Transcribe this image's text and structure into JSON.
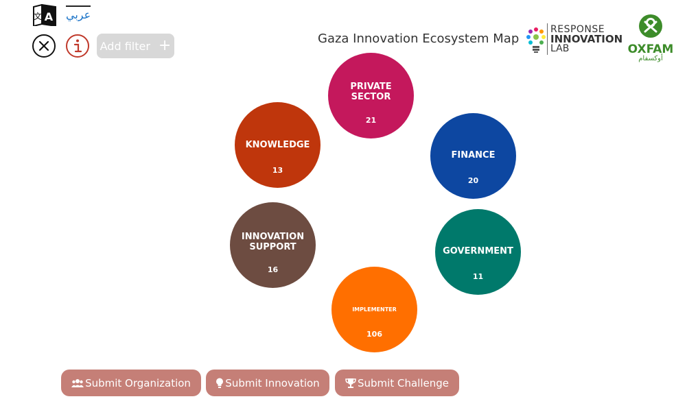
{
  "header": {
    "language_link": "عربي",
    "add_filter_label": "Add filter",
    "add_filter_plus": "+",
    "map_title": "Gaza Innovation Ecosystem Map"
  },
  "icons": {
    "language": "translate-icon",
    "close": "close-icon",
    "info": "info-icon"
  },
  "logos": {
    "response_lab": {
      "line1": "RESPONSE",
      "line2": "INNOVATION",
      "line3": "LAB"
    },
    "oxfam": {
      "word": "OXFAM",
      "arabic": "أوكسفام",
      "color": "#3d8c2a"
    }
  },
  "bubbles": [
    {
      "name": "PRIVATE SECTOR",
      "count": "21",
      "color": "#c4185c"
    },
    {
      "name": "KNOWLEDGE",
      "count": "13",
      "color": "#bf360c"
    },
    {
      "name": "FINANCE",
      "count": "20",
      "color": "#0d47a1"
    },
    {
      "name": "INNOVATION SUPPORT",
      "count": "16",
      "color": "#6d4c41"
    },
    {
      "name": "GOVERNMENT",
      "count": "11",
      "color": "#00796b"
    },
    {
      "name": "IMPLEMENTER",
      "count": "106",
      "color": "#ff6f00"
    }
  ],
  "footer": {
    "submit_organization": "Submit Organization",
    "submit_innovation": "Submit Innovation",
    "submit_challenge": "Submit Challenge",
    "button_color": "#c57f77"
  }
}
